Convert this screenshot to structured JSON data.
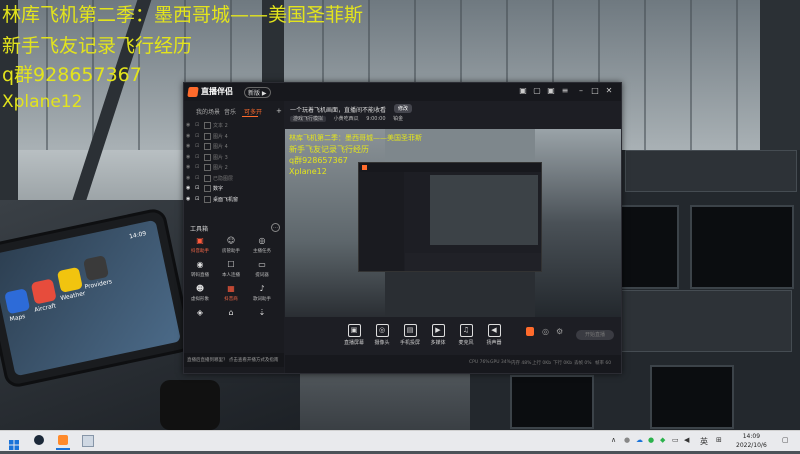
{
  "overlay": {
    "line1": "林库飞机第二季：墨西哥城——美国圣菲斯",
    "line2": "新手飞友记录飞行经历",
    "line3": "q群928657367",
    "line4": "Xplane12"
  },
  "app": {
    "name": "直播伴侣",
    "version_badge": "新版 ▶",
    "left_tabs": [
      "我的场景",
      "音乐",
      "可多开"
    ],
    "sources": [
      {
        "label": "文本 2",
        "on": false
      },
      {
        "label": "图片 4",
        "on": false
      },
      {
        "label": "图片 4",
        "on": false
      },
      {
        "label": "图片 3",
        "on": false
      },
      {
        "label": "图片 2",
        "on": false
      },
      {
        "label": "已隐图层",
        "on": false
      },
      {
        "label": "数字",
        "on": true
      },
      {
        "label": "桌面飞机窗",
        "on": true
      }
    ],
    "tools_title": "工具箱",
    "tools": [
      {
        "label": "抖音助手",
        "red": true,
        "icon": "▣"
      },
      {
        "label": "房管助手",
        "red": false,
        "icon": "☺"
      },
      {
        "label": "主播任务",
        "red": false,
        "icon": "◎"
      },
      {
        "label": "转码直播",
        "red": false,
        "icon": "◉"
      },
      {
        "label": "本人连播",
        "red": false,
        "icon": "☐"
      },
      {
        "label": "提词器",
        "red": false,
        "icon": "▭"
      },
      {
        "label": "虚拟形象",
        "red": false,
        "icon": "☻"
      },
      {
        "label": "抖音商",
        "red": true,
        "icon": "▦"
      },
      {
        "label": "歌词助手",
        "red": false,
        "icon": "♪"
      },
      {
        "label": "",
        "red": false,
        "icon": "◈"
      },
      {
        "label": "",
        "red": false,
        "icon": "⌂"
      },
      {
        "label": "",
        "red": false,
        "icon": "⇣"
      }
    ],
    "notice": "直播后直播到哪里？ 点击查看开播方式及指南",
    "header_line": "一个玩着飞机画面，直播间不能收看",
    "header_pill": "修改",
    "sub_tags": [
      "游戏飞行模拟",
      "小黄吃西瓜",
      "9:00:00",
      "铂金"
    ],
    "bottom_buttons": [
      {
        "label": "直播屏幕",
        "icon": "▣"
      },
      {
        "label": "摄像头",
        "icon": "◎"
      },
      {
        "label": "手机投屏",
        "icon": "▤"
      },
      {
        "label": "多媒体",
        "icon": "▶"
      },
      {
        "label": "麦克风",
        "icon": "♫"
      },
      {
        "label": "扬声器",
        "icon": "◀"
      }
    ],
    "start_button": "开始直播",
    "status_items": [
      "CPU 76%",
      "GPU 34%",
      "内存 48%",
      "上行 0Kb",
      "下行 0Kb",
      "丢帧 0%",
      "帧率 60"
    ],
    "nested_overlay": [
      "林库飞机第二季：墨西哥城——美国圣菲斯",
      "新手飞友记录飞行经历",
      "q群928657367",
      "Xplane12"
    ]
  },
  "taskbar": {
    "time": "14:09",
    "date": "2022/10/6",
    "ime": "英",
    "accent": "#ff6b2c"
  }
}
